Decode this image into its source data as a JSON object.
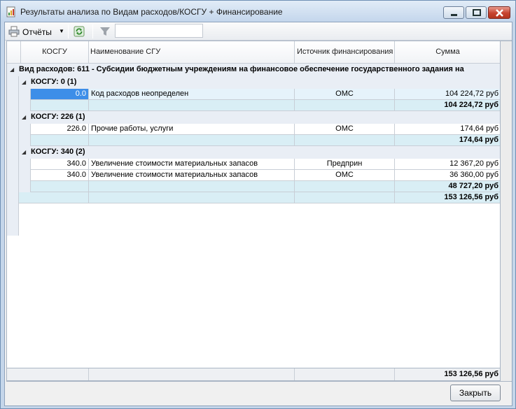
{
  "window": {
    "title": "Результаты анализа по Видам расходов/КОСГУ + Финансирование"
  },
  "toolbar": {
    "reports_label": "Отчёты",
    "filter_value": ""
  },
  "columns": {
    "kosgu": "КОСГУ",
    "name": "Наименование СГУ",
    "source": "Источник финансирования",
    "sum": "Сумма"
  },
  "group_top": {
    "title": "Вид расходов: 611 - Субсидии бюджетным учреждениям на финансовое обеспечение государственного задания на"
  },
  "groups": [
    {
      "title": "КОСГУ: 0 (1)",
      "rows": [
        {
          "kosgu": "0.0",
          "name": "Код расходов неопределен",
          "source": "ОМС",
          "sum": "104 224,72 руб"
        }
      ],
      "subtotal": "104 224,72 руб"
    },
    {
      "title": "КОСГУ: 226 (1)",
      "rows": [
        {
          "kosgu": "226.0",
          "name": "Прочие работы, услуги",
          "source": "ОМС",
          "sum": "174,64 руб"
        }
      ],
      "subtotal": "174,64 руб"
    },
    {
      "title": "КОСГУ: 340 (2)",
      "rows": [
        {
          "kosgu": "340.0",
          "name": "Увеличение стоимости материальных запасов",
          "source": "Предприн",
          "sum": "12 367,20 руб"
        },
        {
          "kosgu": "340.0",
          "name": "Увеличение стоимости материальных запасов",
          "source": "ОМС",
          "sum": "36 360,00 руб"
        }
      ],
      "subtotal": "48 727,20 руб"
    }
  ],
  "group_total": "153 126,56 руб",
  "footer_total": "153 126,56 руб",
  "buttons": {
    "close": "Закрыть"
  },
  "colors": {
    "selected_cell": "#3d8ee8",
    "subtotal_row": "#d9eef5",
    "group_band": "#e9eef5"
  },
  "icons": {
    "app": "report-icon",
    "reports": "printer-icon",
    "refresh": "refresh-icon",
    "filter": "filter-icon"
  }
}
